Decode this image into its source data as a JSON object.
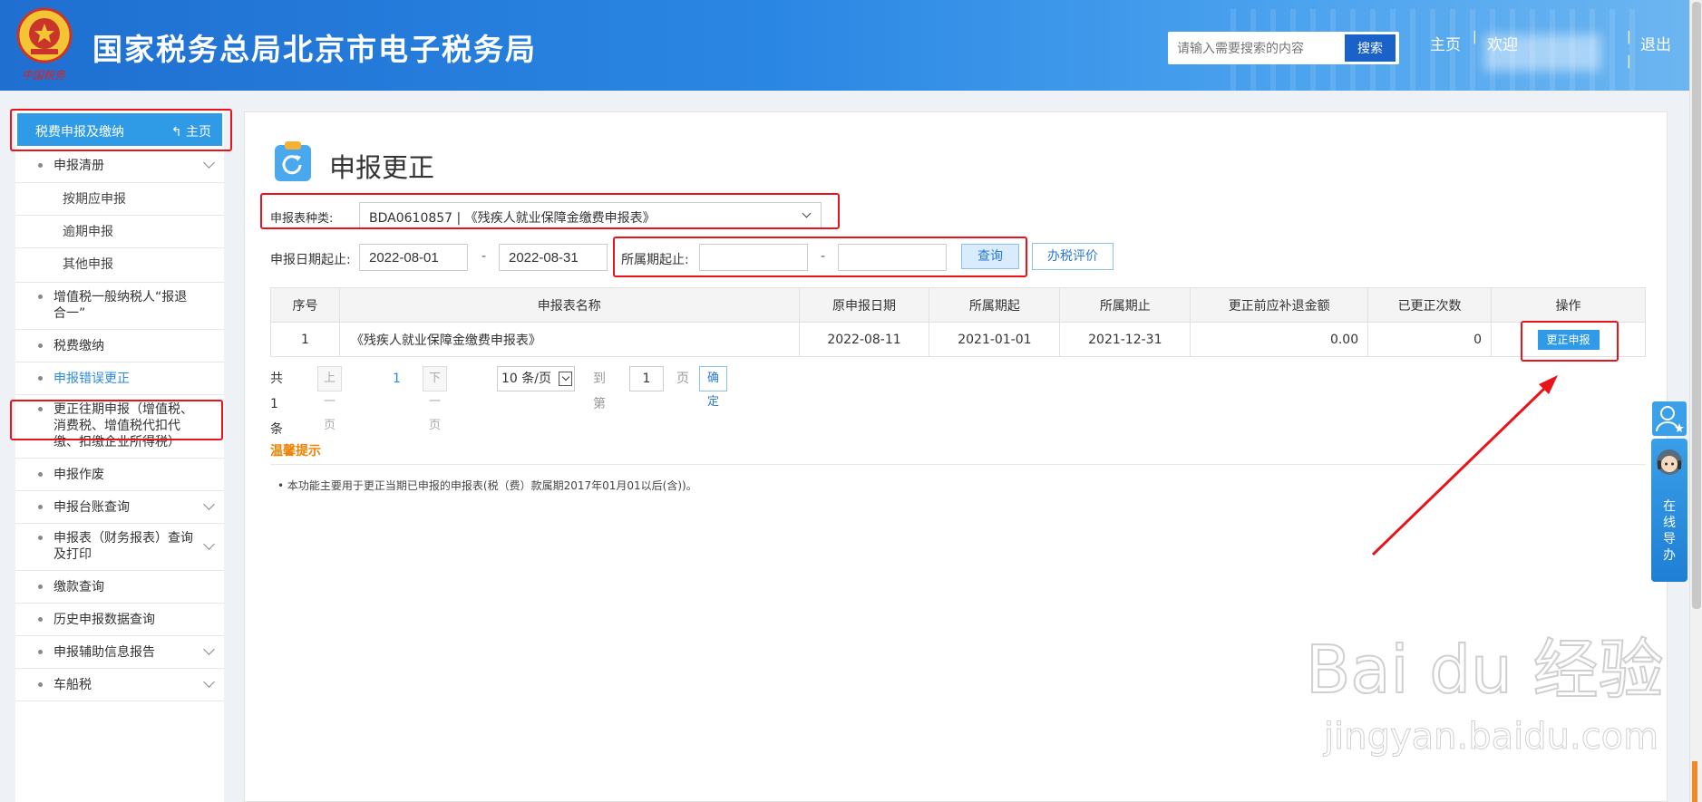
{
  "header": {
    "emblem_text": "中国税务",
    "site_title": "国家税务总局北京市电子税务局",
    "search_placeholder": "请输入需要搜索的内容",
    "search_button": "搜索",
    "home_link": "主页",
    "welcome": "欢迎",
    "logout": "退出"
  },
  "sidebar": {
    "section_title": "税费申报及缴纳",
    "home_link": "主页",
    "items": [
      {
        "label": "申报清册"
      },
      {
        "label": "按期应申报"
      },
      {
        "label": "逾期申报"
      },
      {
        "label": "其他申报"
      },
      {
        "label": "增值税一般纳税人“报退合一”"
      },
      {
        "label": "税费缴纳"
      },
      {
        "label": "申报错误更正"
      },
      {
        "label": "更正往期申报（增值税、消费税、增值税代扣代缴、扣缴企业所得税）"
      },
      {
        "label": "申报作废"
      },
      {
        "label": "申报台账查询"
      },
      {
        "label": "申报表（财务报表）查询及打印"
      },
      {
        "label": "缴款查询"
      },
      {
        "label": "历史申报数据查询"
      },
      {
        "label": "申报辅助信息报告"
      },
      {
        "label": "车船税"
      }
    ]
  },
  "main": {
    "title": "申报更正",
    "form": {
      "type_label": "申报表种类:",
      "type_value": "BDA0610857 | 《残疾人就业保障金缴费申报表》",
      "date_label": "申报日期起止:",
      "date_from": "2022-08-01",
      "date_to": "2022-08-31",
      "range_sep": "-",
      "period_label": "所属期起止:",
      "period_from": "",
      "period_to": "",
      "query_button": "查询",
      "eval_button": "办税评价"
    },
    "table": {
      "headers": [
        "序号",
        "申报表名称",
        "原申报日期",
        "所属期起",
        "所属期止",
        "更正前应补退金额",
        "已更正次数",
        "操作"
      ],
      "rows": [
        {
          "no": "1",
          "name": "《残疾人就业保障金缴费申报表》",
          "orig_date": "2022-08-11",
          "period_start": "2021-01-01",
          "period_end": "2021-12-31",
          "amount": "0.00",
          "count": "0",
          "action": "更正申报"
        }
      ]
    },
    "pager": {
      "total": "共 1 条",
      "prev": "上一页",
      "page": "1",
      "next": "下一页",
      "page_size": "10 条/页",
      "goto_label": "到第",
      "goto_value": "1",
      "page_unit": "页",
      "confirm": "确定"
    },
    "tips": {
      "title": "温馨提示",
      "text": "• 本功能主要用于更正当期已申报的申报表(税（费）款属期2017年01月01以后(含))。"
    }
  },
  "float_widget": {
    "label": "在线导办"
  },
  "watermark": {
    "logo": "Bai du 经验",
    "url": "jingyan.baidu.com"
  },
  "colors": {
    "header": "#2a86e3",
    "accent": "#2f9be6",
    "annotation": "#e8141a",
    "tip": "#f08200"
  }
}
